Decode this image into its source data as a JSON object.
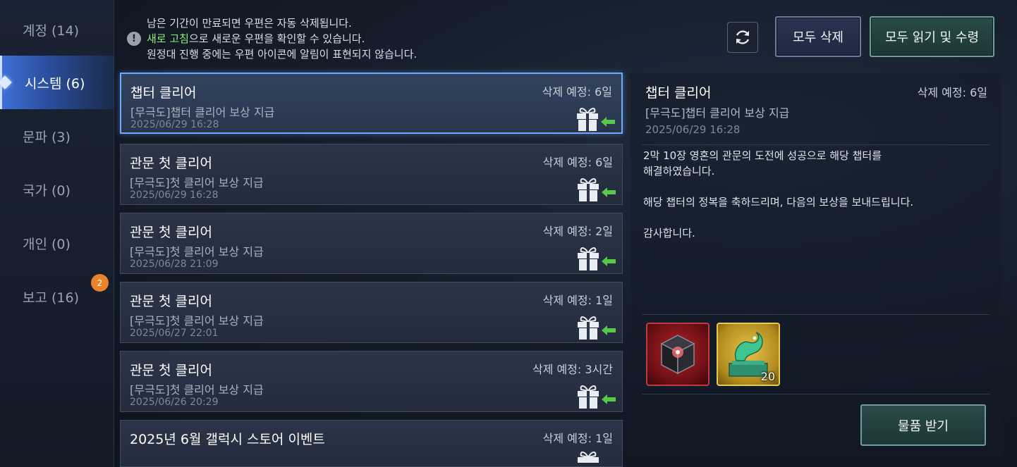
{
  "sidebar": {
    "items": [
      {
        "label": "계정 (14)"
      },
      {
        "label": "시스템 (6)"
      },
      {
        "label": "문파 (3)"
      },
      {
        "label": "국가 (0)"
      },
      {
        "label": "개인 (0)"
      },
      {
        "label": "보고 (16)"
      }
    ],
    "badge": "2"
  },
  "notice": {
    "line1": "남은 기간이 만료되면 우편은 자동 삭제됩니다.",
    "line2_highlight": "새로 고침",
    "line2_rest": "으로 새로운 우편을 확인할 수 있습니다.",
    "line3": "원정대 진행 중에는 우편 아이콘에 알림이 표현되지 않습니다.",
    "icon": "!"
  },
  "toolbar": {
    "delete_all": "모두 삭제",
    "read_all": "모두 읽기 및 수령"
  },
  "mails": [
    {
      "title": "챕터 클리어",
      "sub": "[무극도]챕터 클리어 보상 지급",
      "date": "2025/06/29 16:28",
      "expire": "삭제 예정: 6일"
    },
    {
      "title": "관문 첫 클리어",
      "sub": "[무극도]첫 클리어 보상 지급",
      "date": "2025/06/29 16:28",
      "expire": "삭제 예정: 6일"
    },
    {
      "title": "관문 첫 클리어",
      "sub": "[무극도]첫 클리어 보상 지급",
      "date": "2025/06/28 21:09",
      "expire": "삭제 예정: 2일"
    },
    {
      "title": "관문 첫 클리어",
      "sub": "[무극도]첫 클리어 보상 지급",
      "date": "2025/06/27 22:01",
      "expire": "삭제 예정: 1일"
    },
    {
      "title": "관문 첫 클리어",
      "sub": "[무극도]첫 클리어 보상 지급",
      "date": "2025/06/26 20:29",
      "expire": "삭제 예정: 3시간"
    },
    {
      "title": "2025년 6월 갤럭시 스토어 이벤트",
      "sub": "",
      "date": "",
      "expire": "삭제 예정: 1일"
    }
  ],
  "detail": {
    "title": "챕터 클리어",
    "expire": "삭제 예정: 6일",
    "sub": "[무극도]챕터 클리어 보상 지급",
    "date": "2025/06/29 16:28",
    "body_line1": "2막 10장 영혼의 관문의 도전에 성공으로 해당 챕터를",
    "body_line2": "해결하였습니다.",
    "body_line3": "해당 챕터의 정복을 축하드리며, 다음의 보상을 보내드립니다.",
    "body_line4": "감사합니다.",
    "rewards": [
      {
        "icon": "red-crystal-cube-icon",
        "qty": ""
      },
      {
        "icon": "jade-dragon-seal-icon",
        "qty": "20"
      }
    ],
    "receive_button": "물품 받기"
  },
  "colors": {
    "active_tab": "#3f6fd6",
    "highlight_green": "#8ff07a",
    "badge": "#e8832a",
    "arrow_green": "#57c84a"
  }
}
